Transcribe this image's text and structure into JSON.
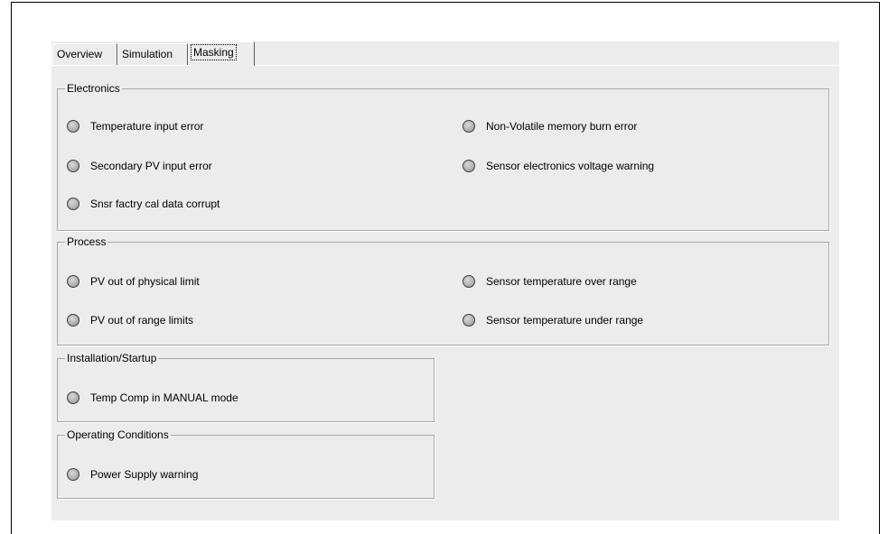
{
  "tabs": [
    {
      "label": "Overview",
      "active": false
    },
    {
      "label": "Simulation",
      "active": false
    },
    {
      "label": "Masking",
      "active": true
    }
  ],
  "groups": {
    "electronics": {
      "title": "Electronics",
      "items": [
        "Temperature input error",
        "Non-Volatile memory burn error",
        "Secondary PV input error",
        "Sensor electronics voltage warning",
        "Snsr factry cal data corrupt"
      ]
    },
    "process": {
      "title": "Process",
      "items": [
        "PV out of physical limit",
        "Sensor temperature over range",
        "PV out of range limits",
        "Sensor temperature under range"
      ]
    },
    "installation": {
      "title": "Installation/Startup",
      "items": [
        "Temp Comp in MANUAL mode"
      ]
    },
    "operating": {
      "title": "Operating Conditions",
      "items": [
        "Power Supply warning"
      ]
    }
  },
  "colors": {
    "panel": "#ececec",
    "indicator_off": "#b4b4b4",
    "group_border": "#a8a8a8"
  },
  "icons": {
    "indicator": "status-led-icon"
  }
}
